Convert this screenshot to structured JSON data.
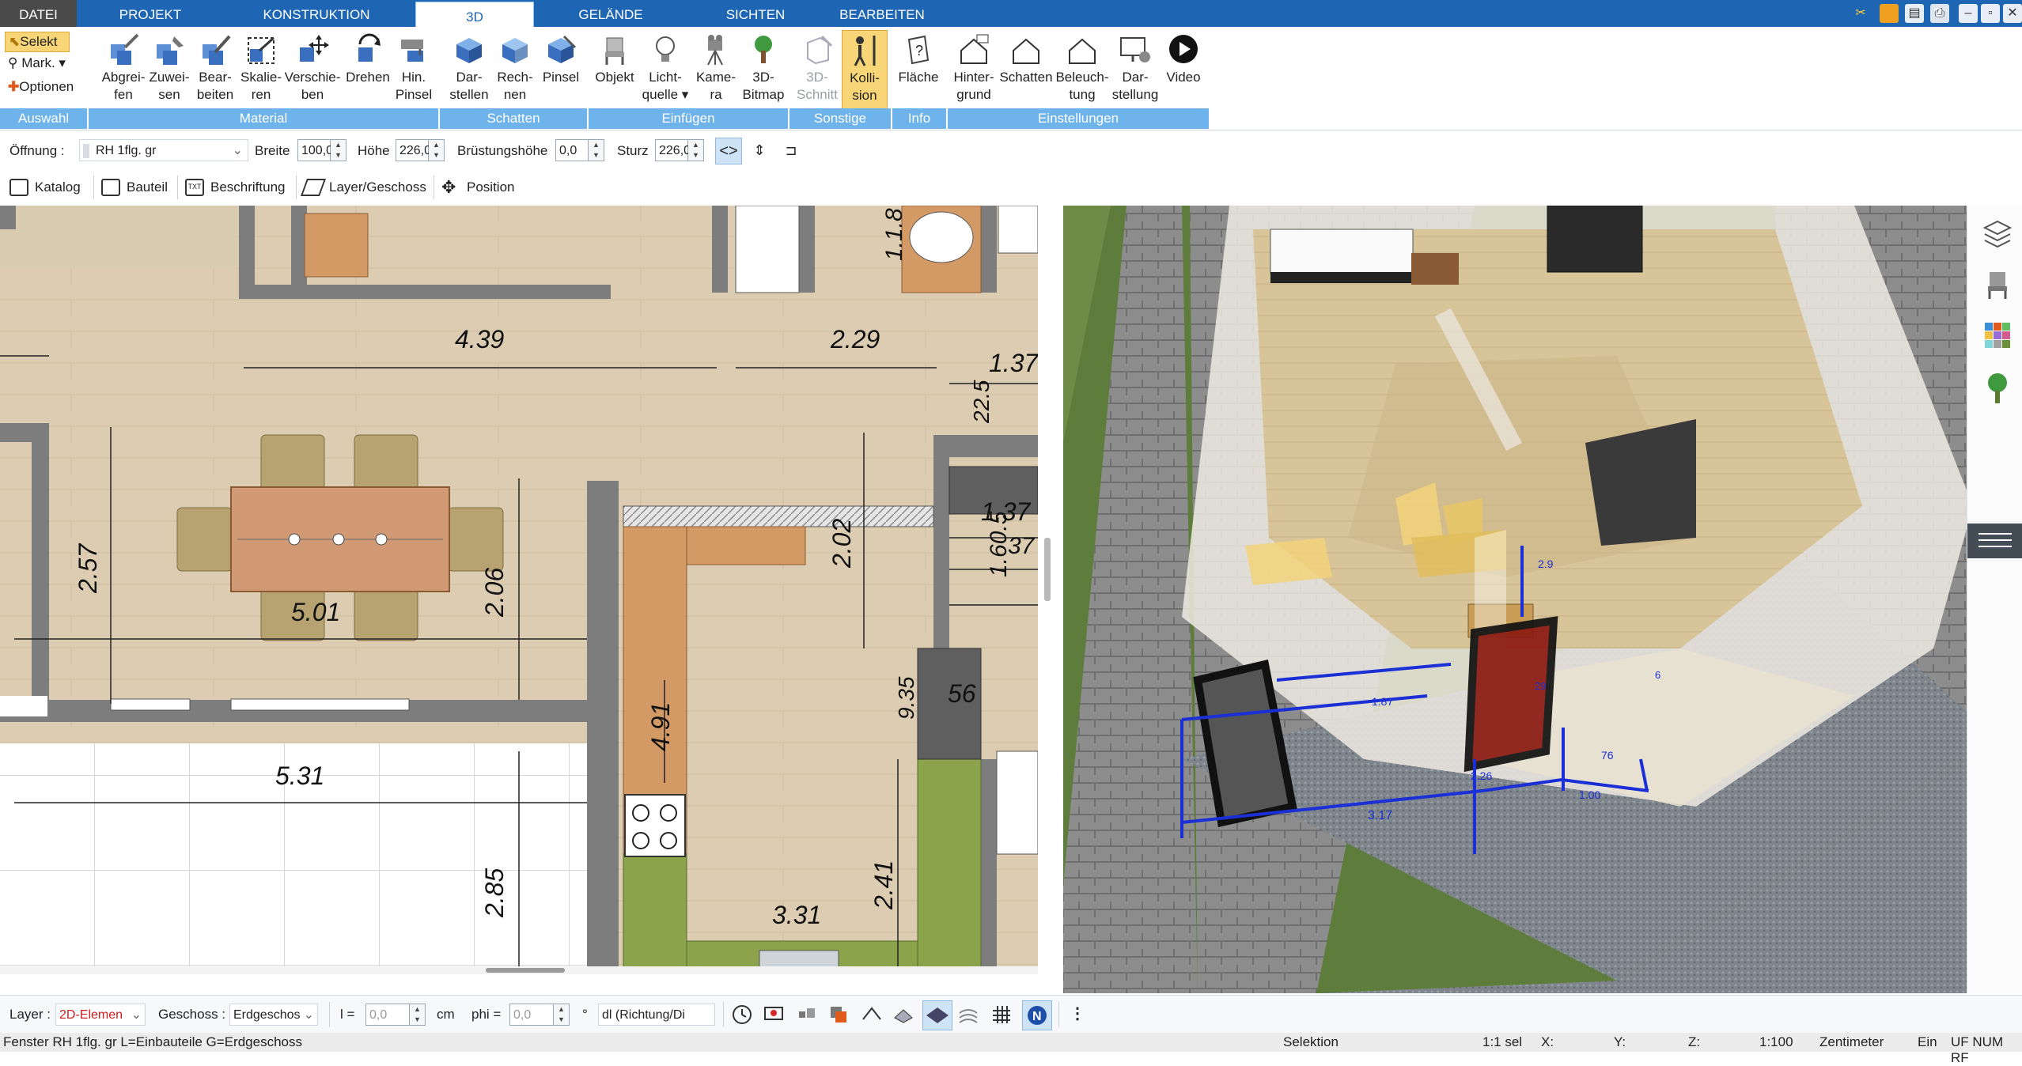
{
  "tabs": {
    "file": "DATEI",
    "project": "PROJEKT",
    "construction": "KONSTRUKTION",
    "threed": "3D",
    "terrain": "GELÄNDE",
    "views": "SICHTEN",
    "edit": "BEARBEITEN"
  },
  "ribbon": {
    "selection": {
      "select": "Selekt",
      "mark": "Mark.",
      "options": "Optionen",
      "group": "Auswahl"
    },
    "material": {
      "group": "Material",
      "pick": [
        "Abgrei-",
        "fen"
      ],
      "assign": [
        "Zuwei-",
        "sen"
      ],
      "edit": [
        "Bear-",
        "beiten"
      ],
      "scale": [
        "Skalie-",
        "ren"
      ],
      "move": [
        "Verschie-",
        "ben"
      ],
      "rotate": "Drehen",
      "bg_brush": [
        "Hin.",
        "Pinsel"
      ]
    },
    "shadow": {
      "group": "Schatten",
      "render": [
        "Dar-",
        "stellen"
      ],
      "compute": [
        "Rech-",
        "nen"
      ],
      "brush": "Pinsel"
    },
    "insert": {
      "group": "Einfügen",
      "object": "Objekt",
      "light": [
        "Licht-",
        "quelle"
      ],
      "camera": [
        "Kame-",
        "ra"
      ],
      "bitmap": [
        "3D-",
        "Bitmap"
      ]
    },
    "misc": {
      "group": "Sonstige",
      "section": [
        "3D-",
        "Schnitt"
      ],
      "collision": [
        "Kolli-",
        "sion"
      ]
    },
    "info": {
      "group": "Info",
      "area": "Fläche"
    },
    "settings": {
      "group": "Einstellungen",
      "background": [
        "Hinter-",
        "grund"
      ],
      "shadows": "Schatten",
      "lighting": [
        "Beleuch-",
        "tung"
      ],
      "display": [
        "Dar-",
        "stellung"
      ],
      "video": "Video"
    }
  },
  "optbar": {
    "opening_label": "Öffnung :",
    "opening_value": "RH 1flg. gr",
    "width_label": "Breite",
    "width_value": "100,0",
    "height_label": "Höhe",
    "height_value": "226,0",
    "sill_label": "Brüstungshöhe",
    "sill_value": "0,0",
    "lintel_label": "Sturz",
    "lintel_value": "226,0"
  },
  "catbar": {
    "catalog": "Katalog",
    "component": "Bauteil",
    "labeling": "Beschriftung",
    "layer": "Layer/Geschoss",
    "position": "Position"
  },
  "plan": {
    "dims": [
      "4.39",
      "2.29",
      "1.37",
      "22.5",
      "2.57",
      "5.01",
      "2.06",
      "2.02",
      "1.37",
      "1.60.5",
      "37",
      "9.35",
      "56",
      "4.91",
      "5.31",
      "2.85",
      "2.41",
      "3.31",
      "1.1.8"
    ]
  },
  "view3d": {
    "dims": [
      "3.17",
      "1.00",
      "2.26",
      "1.87",
      "2.9",
      "76",
      "29",
      "6"
    ]
  },
  "bottombar": {
    "layer_label": "Layer :",
    "layer_value": "2D-Elemen",
    "floor_label": "Geschoss :",
    "floor_value": "Erdgeschos",
    "l_label": "l =",
    "l_value": "0,0",
    "l_unit": "cm",
    "phi_label": "phi =",
    "phi_value": "0,0",
    "phi_unit": "°",
    "direction_value": "dl (Richtung/Di"
  },
  "status": {
    "message": "Fenster RH 1flg. gr L=Einbauteile G=Erdgeschoss",
    "mode": "Selektion",
    "scale": "1:1 sel",
    "x": "X:",
    "y": "Y:",
    "z": "Z:",
    "ratio": "1:100",
    "unit": "Zentimeter",
    "insert": "Ein",
    "flags": "UF NUM RF"
  },
  "colors": {
    "ribbon_blue": "#1e66b3",
    "group_blue": "#6fb3ec",
    "collision_active": "#f8d577",
    "window_red": "#8b1a12",
    "dim_blue": "#1a2fd6"
  }
}
